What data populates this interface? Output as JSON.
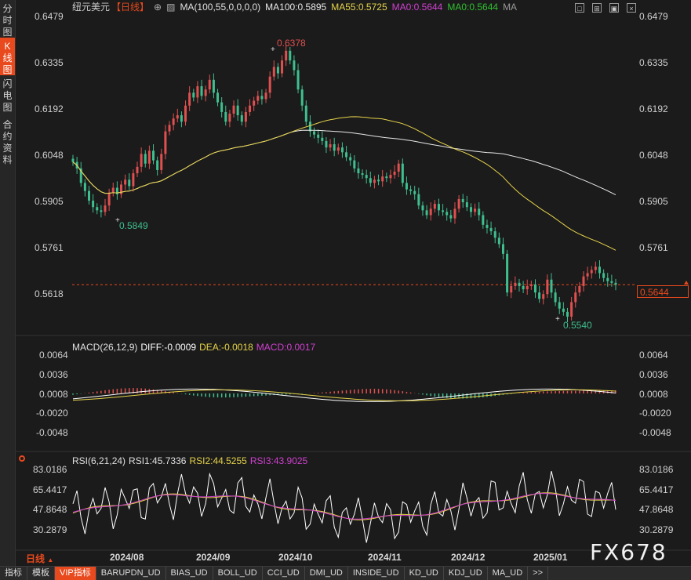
{
  "side_tabs": [
    {
      "label": "分时图",
      "active": false
    },
    {
      "label": "K线图",
      "active": true
    },
    {
      "label": "闪电图",
      "active": false
    },
    {
      "label": "合约资料",
      "active": false
    }
  ],
  "header": {
    "symbol": "纽元美元",
    "period": "【日线】",
    "ma_title": "MA(100,55,0,0,0,0)",
    "ma100": "MA100:0.5895",
    "ma55": "MA55:0.5725",
    "ma0a": "MA0:0.5644",
    "ma0b": "MA0:0.5644",
    "ma_extra": "MA"
  },
  "price_axis": [
    "0.6479",
    "0.6335",
    "0.6192",
    "0.6048",
    "0.5905",
    "0.5761",
    "0.5618"
  ],
  "current_price": "0.5644",
  "annotations": {
    "high": "0.6378",
    "low_left": "0.5849",
    "low_right": "0.5540"
  },
  "macd": {
    "title": "MACD(26,12,9)",
    "diff": "DIFF:-0.0009",
    "dea": "DEA:-0.0018",
    "macd": "MACD:0.0017",
    "axis": [
      "0.0064",
      "0.0036",
      "0.0008",
      "-0.0020",
      "-0.0048"
    ]
  },
  "rsi": {
    "title": "RSI(6,21,24)",
    "rsi1": "RSI1:45.7336",
    "rsi2": "RSI2:44.5255",
    "rsi3": "RSI3:43.9025",
    "axis": [
      "83.0186",
      "65.4417",
      "47.8648",
      "30.2879"
    ]
  },
  "period_button": "日线",
  "dates": [
    "2024/08",
    "2024/09",
    "2024/10",
    "2024/11",
    "2024/12",
    "2025/01"
  ],
  "watermark": "FX678",
  "bottom_tabs": [
    "指标",
    "模板",
    "VIP指标",
    "BARUPDN_UD",
    "BIAS_UD",
    "BOLL_UD",
    "CCI_UD",
    "DMI_UD",
    "INSIDE_UD",
    "KD_UD",
    "KDJ_UD",
    "MA_UD",
    ">>"
  ],
  "bottom_active": "VIP指标",
  "colors": {
    "up": "#e05050",
    "down": "#3fbf8f",
    "ma100": "#e8e8e8",
    "ma55": "#e6d34a",
    "rsi1": "#ffffff",
    "rsi2": "#e6d34a",
    "rsi3": "#d040d0",
    "accent": "#e8491d"
  },
  "chart_data": {
    "type": "candlestick",
    "ohlc_close": [
      0.6025,
      0.6005,
      0.596,
      0.5935,
      0.5905,
      0.5885,
      0.5875,
      0.587,
      0.589,
      0.593,
      0.5945,
      0.5925,
      0.5955,
      0.597,
      0.595,
      0.599,
      0.601,
      0.605,
      0.602,
      0.606,
      0.603,
      0.6,
      0.605,
      0.612,
      0.614,
      0.616,
      0.617,
      0.615,
      0.62,
      0.624,
      0.6225,
      0.626,
      0.623,
      0.625,
      0.628,
      0.624,
      0.621,
      0.618,
      0.615,
      0.6175,
      0.62,
      0.617,
      0.615,
      0.618,
      0.62,
      0.6215,
      0.623,
      0.622,
      0.624,
      0.629,
      0.632,
      0.63,
      0.634,
      0.637,
      0.634,
      0.631,
      0.625,
      0.62,
      0.615,
      0.612,
      0.611,
      0.61,
      0.609,
      0.607,
      0.608,
      0.606,
      0.607,
      0.6055,
      0.604,
      0.603,
      0.6005,
      0.599,
      0.5985,
      0.5975,
      0.596,
      0.597,
      0.5965,
      0.598,
      0.5975,
      0.5985,
      0.5995,
      0.602,
      0.596,
      0.594,
      0.5935,
      0.5925,
      0.589,
      0.5875,
      0.586,
      0.588,
      0.5895,
      0.5875,
      0.587,
      0.586,
      0.585,
      0.588,
      0.591,
      0.59,
      0.5885,
      0.587,
      0.588,
      0.586,
      0.583,
      0.582,
      0.581,
      0.579,
      0.577,
      0.574,
      0.562,
      0.564,
      0.565,
      0.564,
      0.563,
      0.564,
      0.5645,
      0.562,
      0.56,
      0.5615,
      0.566,
      0.562,
      0.559,
      0.557,
      0.556,
      0.5545,
      0.559,
      0.562,
      0.564,
      0.567,
      0.568,
      0.569,
      0.57,
      0.568,
      0.5665,
      0.5655,
      0.565,
      0.5644
    ],
    "xlabel": "",
    "ylabel": ""
  }
}
